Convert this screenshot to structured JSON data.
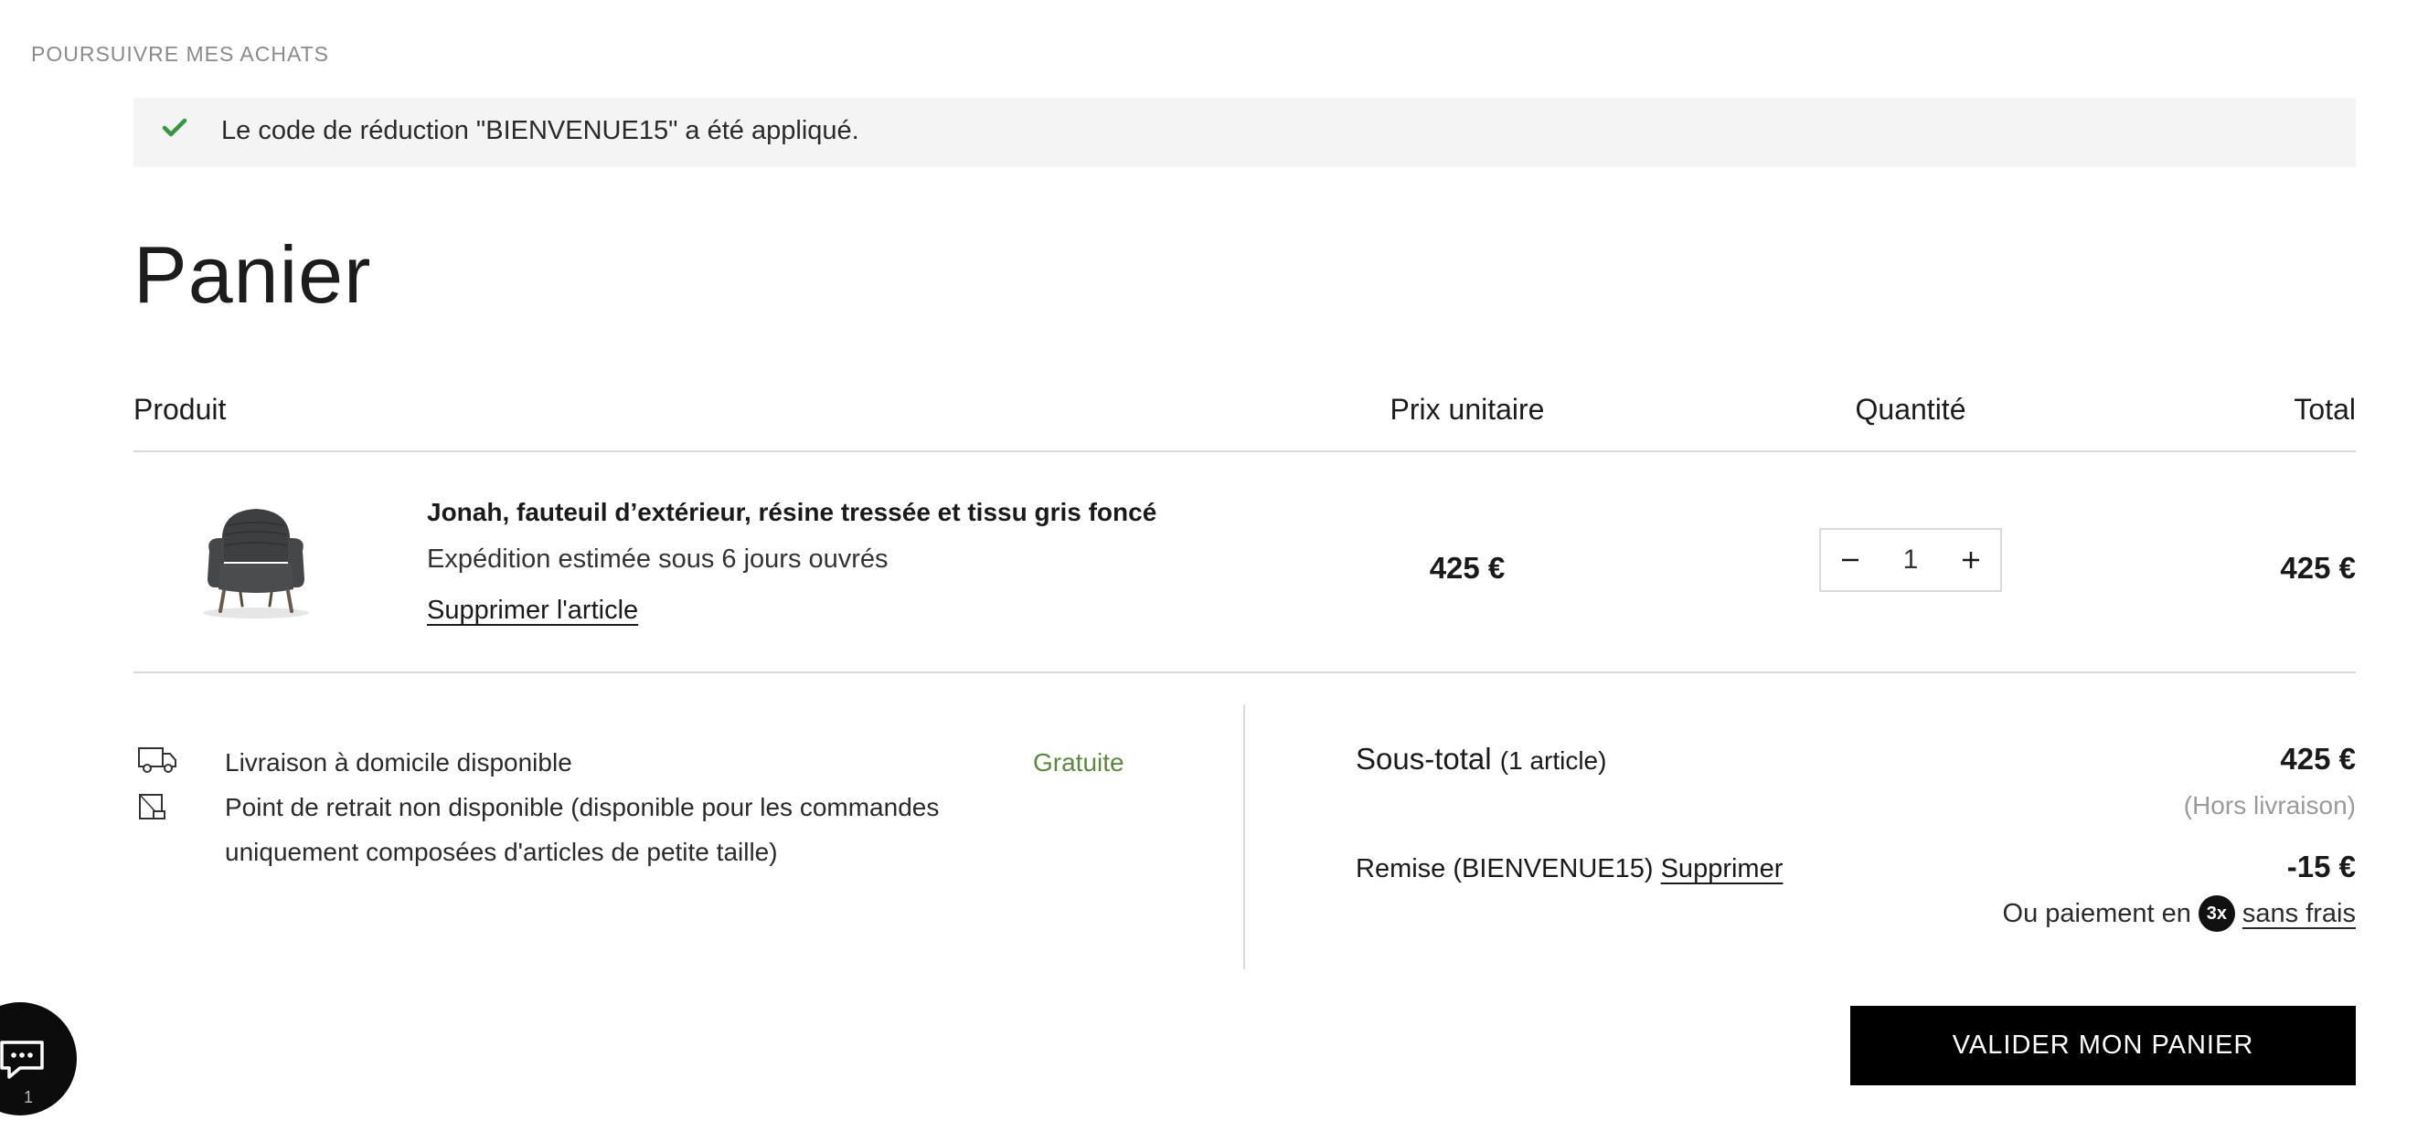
{
  "continue_label": "POURSUIVRE MES ACHATS",
  "notice": {
    "message": "Le code de réduction \"BIENVENUE15\" a été appliqué.",
    "icon": "check-icon",
    "icon_color": "#2e9c3a"
  },
  "title": "Panier",
  "columns": {
    "produit": "Produit",
    "prix": "Prix unitaire",
    "quantite": "Quantité",
    "total": "Total"
  },
  "item": {
    "name": "Jonah, fauteuil d’extérieur, résine tressée et tissu gris foncé",
    "shipping": "Expédition estimée sous 6 jours ouvrés",
    "remove_label": "Supprimer l'article",
    "unit_price": "425 €",
    "quantity": "1",
    "total": "425 €"
  },
  "delivery": {
    "home": "Livraison à domicile disponible",
    "home_price": "Gratuite",
    "pickup": "Point de retrait non disponible (disponible pour les commandes uniquement composées d'articles de petite taille)"
  },
  "summary": {
    "subtotal_label": "Sous-total",
    "subtotal_count": "(1 article)",
    "subtotal_value": "425 €",
    "excl_shipping": "(Hors livraison)",
    "discount_label": "Remise (BIENVENUE15)",
    "discount_remove": "Supprimer",
    "discount_value": "-15 €",
    "pay_prefix": "Ou paiement en",
    "pay_badge": "3x",
    "pay_link": "sans frais"
  },
  "validate_label": "VALIDER MON PANIER",
  "chat": {
    "icon": "chat-icon",
    "count": "1"
  },
  "colors": {
    "accent": "#000000",
    "free": "#5a8a3a",
    "notice_bg": "#f4f4f4"
  }
}
